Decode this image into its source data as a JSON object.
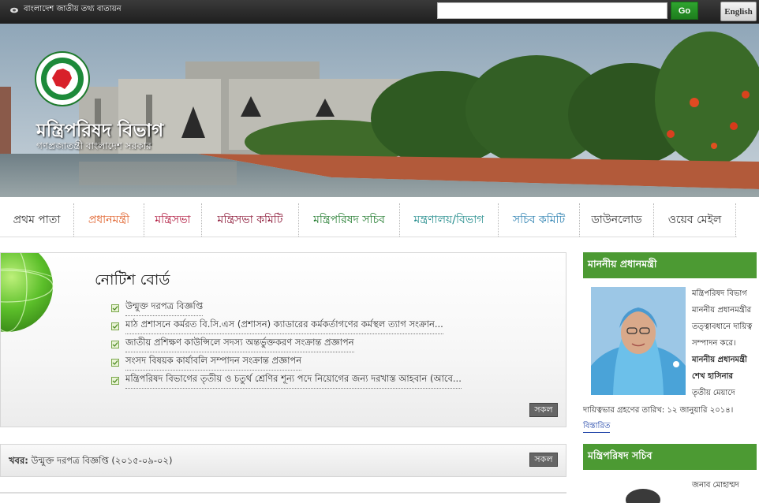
{
  "topbar": {
    "portal_label": "বাংলাদেশ জাতীয় তথ্য বাতায়ন",
    "search_placeholder": "",
    "go_label": "Go",
    "language_label": "English"
  },
  "banner": {
    "title": "মন্ত্রিপরিষদ বিভাগ",
    "subtitle": "গণপ্রজাতন্ত্রী বাংলাদেশ সরকার",
    "emblem_text": "গণপ্রজাতন্ত্রী বাংলাদেশ সরকার"
  },
  "nav": {
    "items": [
      {
        "label": "প্রথম পাতা",
        "color": "#333333"
      },
      {
        "label": "প্রধানমন্ত্রী",
        "color": "#e0612a"
      },
      {
        "label": "মন্ত্রিসভা",
        "color": "#b0163c"
      },
      {
        "label": "মন্ত্রিসভা কমিটি",
        "color": "#8a1535"
      },
      {
        "label": "মন্ত্রিপরিষদ সচিব",
        "color": "#1f7a2c"
      },
      {
        "label": "মন্ত্রণালয়/বিভাগ",
        "color": "#1f8a8a"
      },
      {
        "label": "সচিব কমিটি",
        "color": "#2a7fb0"
      },
      {
        "label": "ডাউনলোড",
        "color": "#333333"
      },
      {
        "label": "ওয়েব মেইল",
        "color": "#333333"
      }
    ]
  },
  "notice": {
    "title": "নোটিশ বোর্ড",
    "items": [
      "উন্মুক্ত দরপত্র বিজ্ঞপ্তি",
      "মাঠ প্রশাসনে কর্মরত বি.সি.এস (প্রশাসন) ক্যাডারের কর্মকর্তাগণের কর্মস্থল ত্যাগ সংক্রান...",
      "জাতীয় প্রশিক্ষণ কাউন্সিলে সদস্য অন্তর্ভুক্তকরণ সংক্রান্ত প্রজ্ঞাপন",
      "সংসদ বিষয়ক কার্যাবলি সম্পাদন সংক্রান্ত প্রজ্ঞাপন",
      "মন্ত্রিপরিষদ বিভাগের তৃতীয় ও চতুর্থ শ্রেণির শূন্য পদে নিয়োগের জন্য দরখাস্ত আহবান (আবে..."
    ],
    "all_label": "সকল"
  },
  "news": {
    "prefix": "খবর:",
    "text": " উন্মুক্ত দরপত্র বিজ্ঞপ্তি (২০১৫-০৯-০২)",
    "all_label": "সকল"
  },
  "sidebar": {
    "pm_heading": "মাননীয় প্রধানমন্ত্রী",
    "pm_lines": [
      "মন্ত্রিপরিষদ বিভাগ",
      "মাননীয় প্রধানমন্ত্রীর",
      "তত্ত্বাবধানে দায়িত্ব",
      "সম্পাদন করে।",
      "মাননীয় প্রধানমন্ত্রী",
      "শেখ হাসিনার",
      "তৃতীয় মেয়াদে"
    ],
    "pm_full_line": "দায়িত্বভার গ্রহণের তারিখ: ১২ জানুয়ারি ২০১৪।",
    "read_more": "বিস্তারিত",
    "secretary_heading": "মন্ত্রিপরিষদ সচিব",
    "secretary_line": "জনাব মোহাম্মদ"
  },
  "colors": {
    "accent_green": "#4c9a33",
    "go_button": "#239323",
    "topbar": "#2a2a2a"
  }
}
